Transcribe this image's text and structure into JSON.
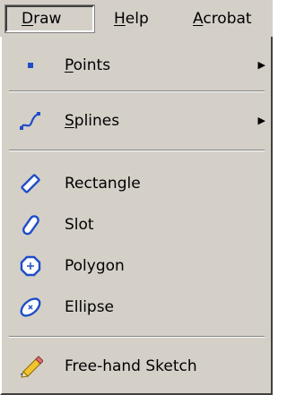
{
  "menubar": {
    "draw": {
      "before": "",
      "accel": "D",
      "after": "raw"
    },
    "help": {
      "before": "",
      "accel": "H",
      "after": "elp"
    },
    "acrobat": {
      "before": "",
      "accel": "A",
      "after": "crobat"
    }
  },
  "menu": {
    "points": {
      "before": "",
      "accel": "P",
      "after": "oints",
      "icon": "point-icon",
      "has_submenu": true
    },
    "splines": {
      "before": "",
      "accel": "S",
      "after": "plines",
      "icon": "spline-icon",
      "has_submenu": true
    },
    "rectangle": {
      "label": "Rectangle",
      "icon": "rectangle-icon"
    },
    "slot": {
      "label": "Slot",
      "icon": "slot-icon"
    },
    "polygon": {
      "label": "Polygon",
      "icon": "polygon-icon"
    },
    "ellipse": {
      "label": "Ellipse",
      "icon": "ellipse-icon"
    },
    "freehand": {
      "label": "Free-hand Sketch",
      "icon": "pencil-icon"
    }
  },
  "colors": {
    "menu_bg": "#d4d0c8",
    "icon_blue": "#1f4dc8",
    "submenu_arrow": "▶"
  }
}
